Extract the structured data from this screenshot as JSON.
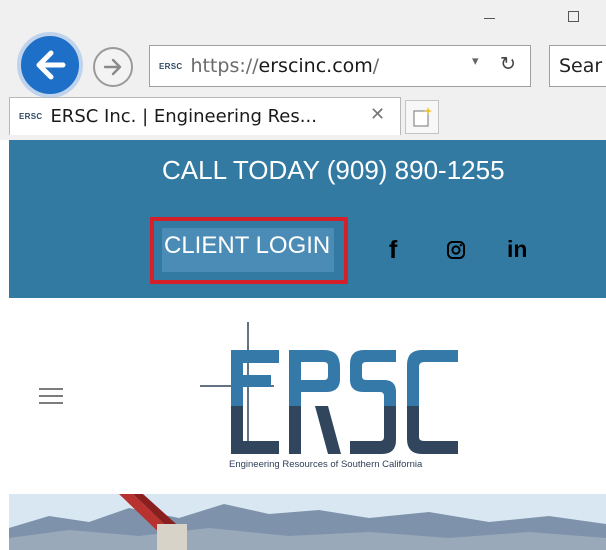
{
  "browser": {
    "url_scheme": "https://",
    "url_host": "erscinc.com",
    "url_rest": "/",
    "search_placeholder": "Sear",
    "tab_title": "ERSC Inc. | Engineering Res...",
    "favicon_text": "ERSC",
    "icons": [
      "back-arrow-icon",
      "forward-arrow-icon",
      "dropdown-icon",
      "refresh-icon",
      "close-icon",
      "new-tab-icon",
      "minimize-icon",
      "maximize-icon"
    ]
  },
  "header": {
    "call_text": "CALL TODAY (909) 890-1255",
    "login_label": "CLIENT LOGIN",
    "social": {
      "facebook": "f",
      "linkedin": "in"
    }
  },
  "logo": {
    "text": "ERSC",
    "tagline": "Engineering Resources of Southern California"
  },
  "colors": {
    "header_bg": "#337aa3",
    "highlight_frame": "#d4202a",
    "logo_blue": "#3579a8",
    "logo_navy": "#31455c",
    "back_button": "#1e6fc7"
  }
}
